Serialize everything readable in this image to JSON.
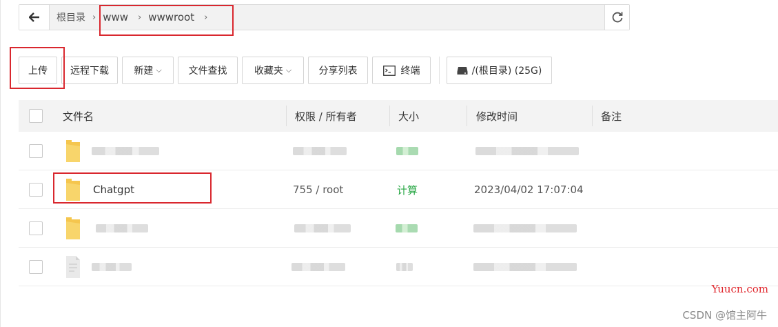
{
  "path": {
    "root": "根目录",
    "segments": [
      "www",
      "wwwroot"
    ]
  },
  "toolbar": {
    "upload": "上传",
    "remote_download": "远程下载",
    "new": "新建",
    "search": "文件查找",
    "favorites": "收藏夹",
    "share_list": "分享列表",
    "terminal": "终端",
    "disk": "/(根目录) (25G)"
  },
  "columns": {
    "name": "文件名",
    "perm": "权限 / 所有者",
    "size": "大小",
    "mtime": "修改时间",
    "note": "备注"
  },
  "rows": [
    {
      "name": "",
      "perm": "",
      "size": "",
      "mtime": "",
      "type": "folder"
    },
    {
      "name": "Chatgpt",
      "perm": "755 / root",
      "size": "计算",
      "mtime": "2023/04/02 17:07:04",
      "type": "folder"
    },
    {
      "name": "",
      "perm": "",
      "size": "",
      "mtime": "",
      "type": "folder"
    },
    {
      "name": "",
      "perm": "",
      "size": "",
      "mtime": "",
      "type": "file"
    }
  ],
  "watermarks": {
    "site": "Yuucn.com",
    "csdn": "CSDN @馆主阿牛"
  },
  "colors": {
    "highlight_box": "#d9272e",
    "folder": "#f5c64e",
    "size_link": "#28a745"
  }
}
